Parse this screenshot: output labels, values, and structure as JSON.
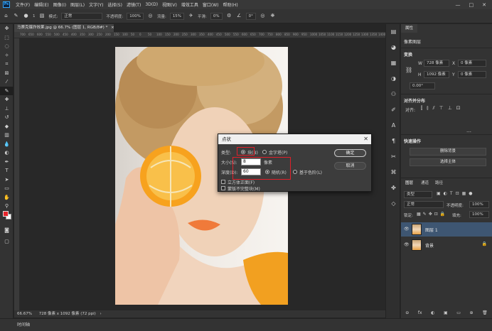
{
  "menubar": {
    "logo": "Ps",
    "items": [
      "文件(F)",
      "编辑(E)",
      "图像(I)",
      "图层(L)",
      "文字(Y)",
      "选择(S)",
      "滤镜(T)",
      "3D(D)",
      "视图(V)",
      "增效工具",
      "窗口(W)",
      "帮助(H)"
    ],
    "win": {
      "min": "—",
      "max": "□",
      "close": "✕"
    }
  },
  "options": {
    "mode_label": "模式:",
    "mode_value": "正常",
    "opacity_label": "不透明度:",
    "opacity_value": "100%",
    "flow_label": "流量:",
    "flow_value": "15%",
    "smooth_label": "平滑:",
    "smooth_value": "0%",
    "angle_value": "0°",
    "brush_size": "1"
  },
  "document": {
    "tab": "马赛克爆炸效果.jpg @ 66.7% (图层 1, RGB/8#) *",
    "close": "×",
    "ruler_ticks": [
      "700",
      "650",
      "600",
      "550",
      "500",
      "450",
      "400",
      "350",
      "300",
      "250",
      "200",
      "150",
      "100",
      "50",
      "0",
      "50",
      "100",
      "150",
      "200",
      "250",
      "300",
      "350",
      "400",
      "450",
      "500",
      "550",
      "600",
      "650",
      "700",
      "750",
      "800",
      "850",
      "900",
      "950",
      "1000",
      "1050",
      "1100",
      "1150",
      "1200",
      "1250",
      "1300",
      "1350",
      "1400",
      "1450"
    ]
  },
  "status": {
    "zoom": "66.67%",
    "size": "728 像素 x 1092 像素 (72 ppi)",
    "arrow": "›"
  },
  "timeline": {
    "label": "时间轴"
  },
  "dialog": {
    "title": "点状",
    "close": "✕",
    "type_label": "类型:",
    "type_opt1": "块(B)",
    "type_opt2": "金字塔(P)",
    "size_label": "大小(S):",
    "size_value": "8",
    "size_unit": "像素",
    "depth_label": "深度(D):",
    "depth_value": "60",
    "depth_opt1": "随机(R)",
    "depth_opt2": "基于色阶(L)",
    "check1": "立方体正面(F)",
    "check2": "蒙版不完整块(M)",
    "ok": "确定",
    "cancel": "取消"
  },
  "properties": {
    "tabs": [
      "属性"
    ],
    "doc_label": "像素图层",
    "transform_title": "变换",
    "w_label": "W",
    "w_value": "728 像素",
    "h_label": "H",
    "h_value": "1092 像素",
    "x_label": "X",
    "x_value": "0 像素",
    "y_label": "Y",
    "y_value": "0 像素",
    "angle": "0.00°",
    "align_title": "对齐并分布",
    "align_label": "对齐:",
    "quick_title": "快速操作",
    "btn_remove_bg": "删除背景",
    "btn_select_subject": "选择主体"
  },
  "layers": {
    "tabs": [
      "图层",
      "通道",
      "路径"
    ],
    "kind_label": "类型",
    "blend": "正常",
    "opacity_label": "不透明度:",
    "opacity_value": "100%",
    "lock_label": "锁定:",
    "fill_label": "填充:",
    "fill_value": "100%",
    "items": [
      {
        "name": "图层 1",
        "selected": true
      },
      {
        "name": "背景",
        "selected": false
      }
    ],
    "footer": [
      "⊖",
      "fx",
      "◐",
      "▣",
      "▭",
      "⊕",
      "🗑"
    ]
  },
  "colors": {
    "foreground": "#e6252b",
    "background": "#ffffff",
    "highlight_box": "#e0202a",
    "layer_selected": "#3e5672"
  }
}
